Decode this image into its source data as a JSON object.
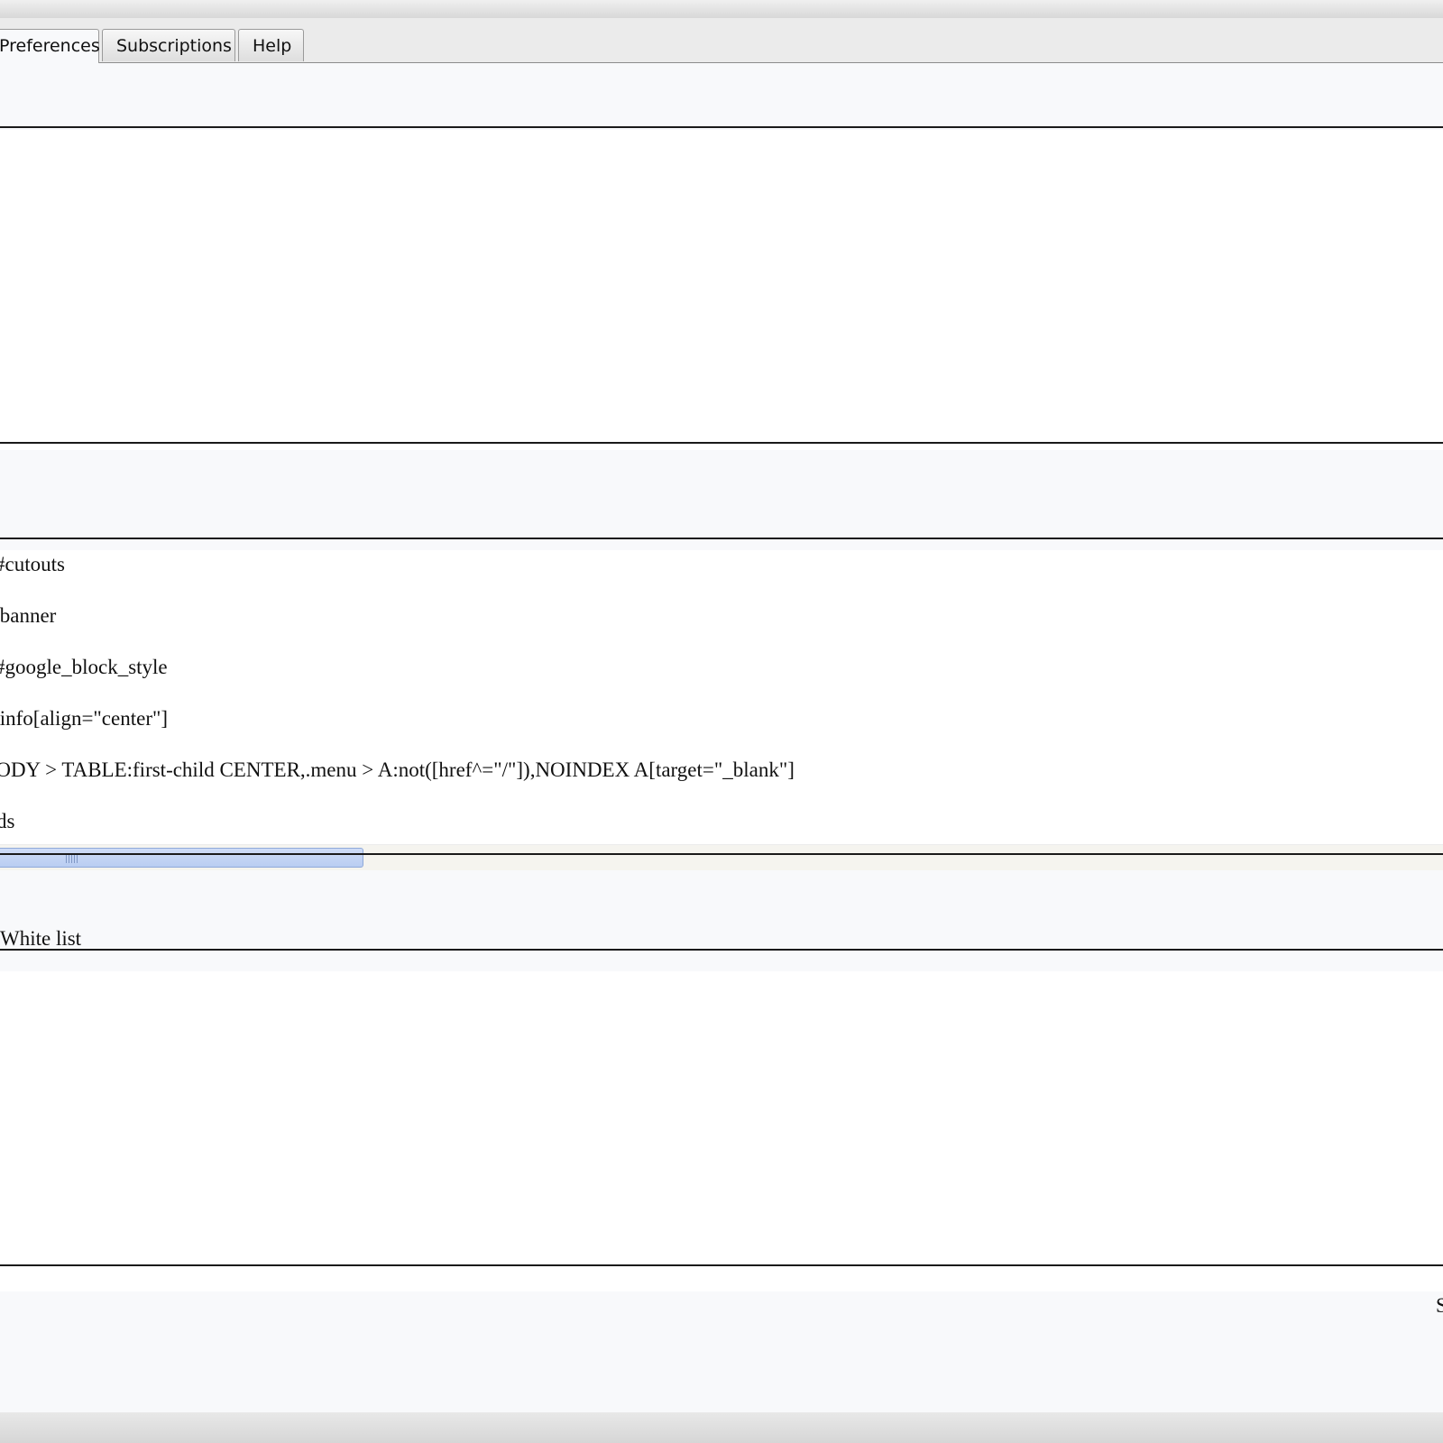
{
  "tabs": [
    {
      "label": "Preferences",
      "active": true
    },
    {
      "label": "Subscriptions",
      "active": false
    },
    {
      "label": "Help",
      "active": false
    }
  ],
  "rules": [
    "#cutouts",
    ".banner",
    "#google_block_style",
    ".info[align=\"center\"]",
    "BODY > TABLE:first-child CENTER,.menu > A:not([href^=\"/\"]),NOINDEX A[target=\"_blank\"]",
    ".ads"
  ],
  "white_list": {
    "label": "White list"
  },
  "footer": {
    "partial_text": "S"
  },
  "colors": {
    "panel_bg": "#f8f9fb",
    "list_bg": "#ffffff",
    "scroll_thumb": "#b9cdf2"
  }
}
